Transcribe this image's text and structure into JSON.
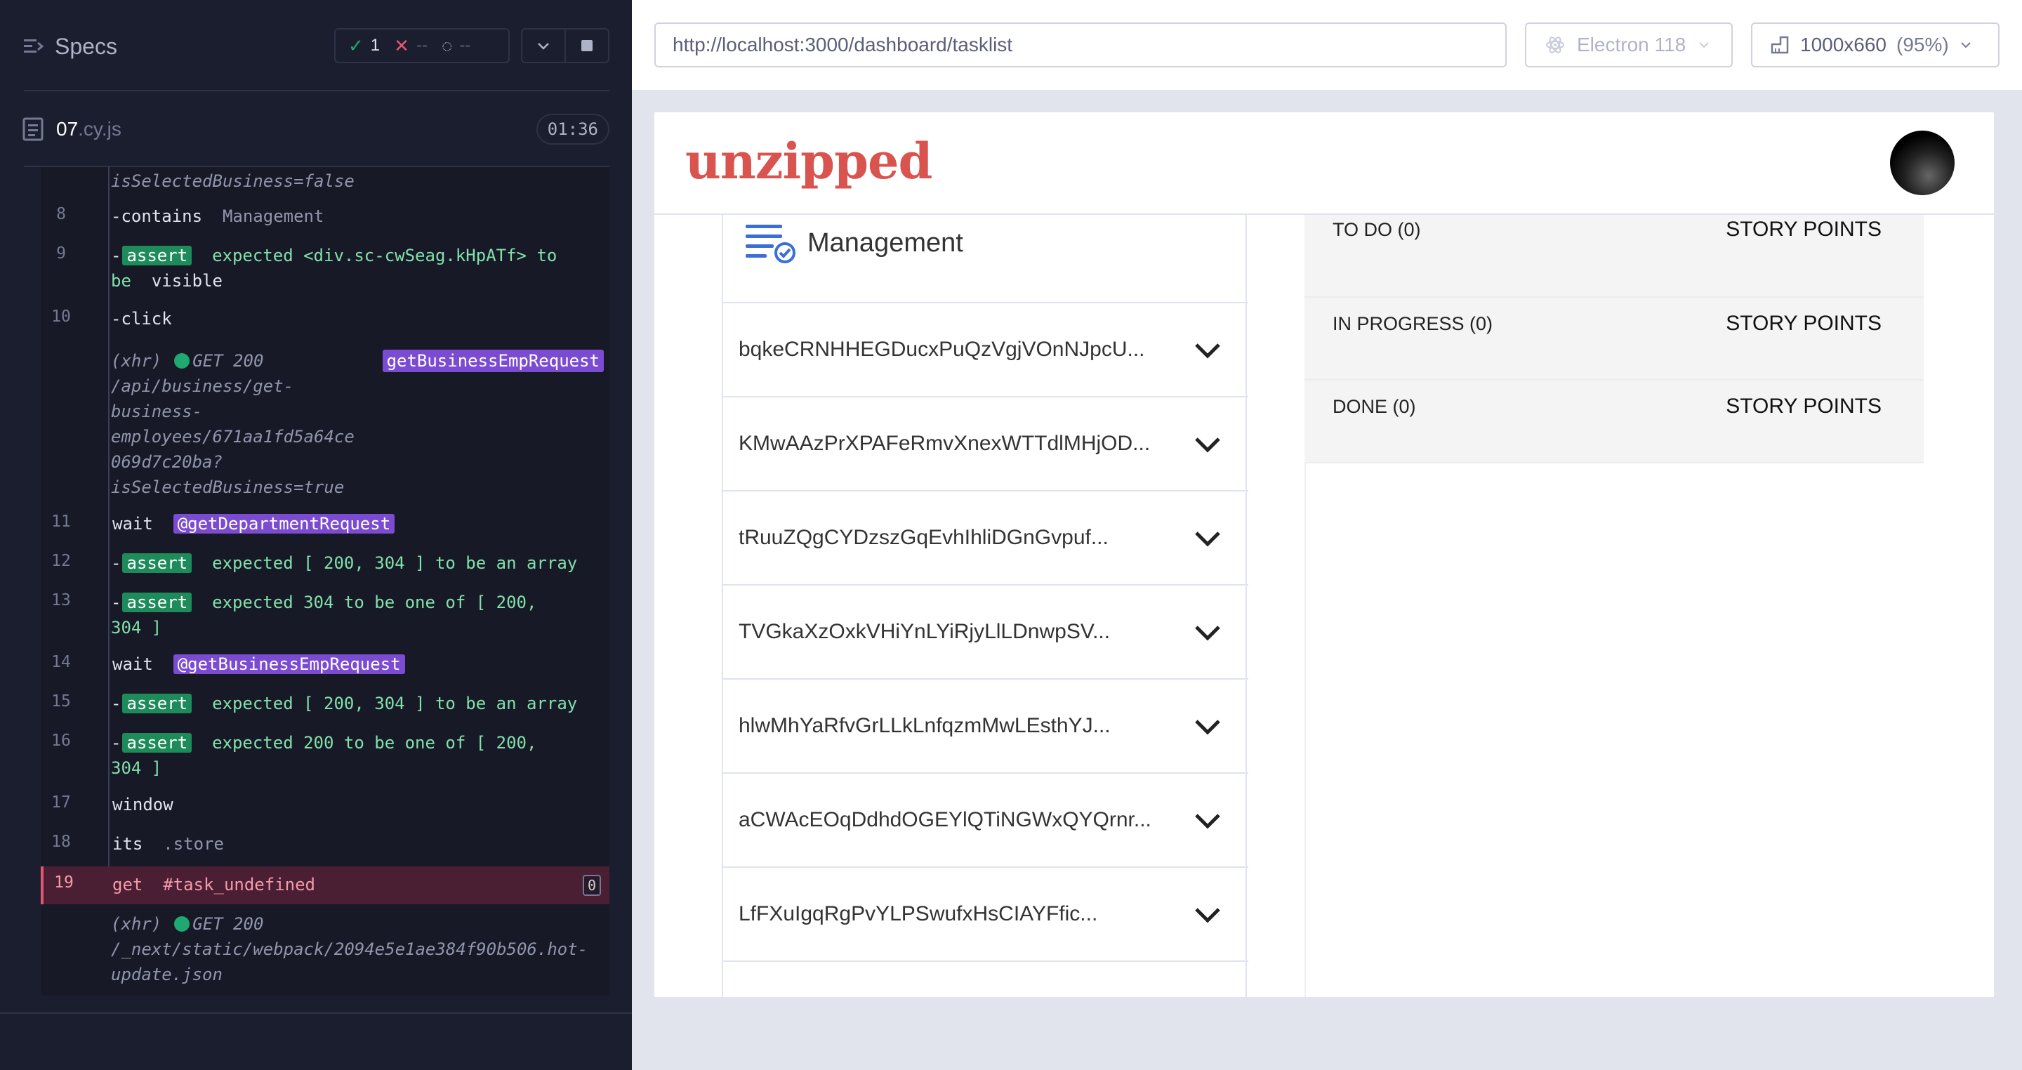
{
  "reporter": {
    "specs_label": "Specs",
    "stats": {
      "passed": "1",
      "failed": "--",
      "pending": "--"
    },
    "spec": {
      "name": "07",
      "ext": ".cy.js",
      "duration": "01:36"
    }
  },
  "commands": [
    {
      "num": "",
      "text": "isSelectedBusiness=false"
    },
    {
      "num": "8",
      "name": "-contains",
      "arg": "Management"
    },
    {
      "num": "9",
      "badge": "assert",
      "line1": "expected <div.sc-cwSeag.kHpATf> to",
      "line2a": "be",
      "line2b": "visible"
    },
    {
      "num": "10",
      "name": "-click"
    },
    {
      "num": "",
      "xhr": "(xhr)",
      "method": "GET 200",
      "alias": "getBusinessEmpRequest",
      "url_lines": [
        "/api/business/get-",
        "business-",
        "employees/671aa1fd5a64ce",
        "069d7c20ba?",
        "isSelectedBusiness=true"
      ]
    },
    {
      "num": "11",
      "name": "wait",
      "alias": "@getDepartmentRequest"
    },
    {
      "num": "12",
      "badge": "assert",
      "text": "expected [ 200, 304 ] to be an array"
    },
    {
      "num": "13",
      "badge": "assert",
      "line1": "expected 304 to be one of [ 200,",
      "line2": "304 ]"
    },
    {
      "num": "14",
      "name": "wait",
      "alias": "@getBusinessEmpRequest"
    },
    {
      "num": "15",
      "badge": "assert",
      "text": "expected [ 200, 304 ] to be an array"
    },
    {
      "num": "16",
      "badge": "assert",
      "line1": "expected 200 to be one of [ 200,",
      "line2": "304 ]"
    },
    {
      "num": "17",
      "name": "window"
    },
    {
      "num": "18",
      "name": "its",
      "arg": ".store"
    },
    {
      "num": "19",
      "name": "get",
      "arg": "#task_undefined",
      "count": "0"
    },
    {
      "num": "",
      "xhr": "(xhr)",
      "method": "GET 200",
      "url_lines": [
        "/_next/static/webpack/2094e5e1ae384f90b506.hot-",
        "update.json"
      ]
    }
  ],
  "browser": {
    "url": "http://localhost:3000/dashboard/tasklist",
    "name": "Electron 118",
    "viewport": "1000x660",
    "scale": "(95%)"
  },
  "app": {
    "logo": "unzipped",
    "column_title": "Management",
    "tasks": [
      "bqkeCRNHHEGDucxPuQzVgjVOnNJpcU...",
      "KMwAAzPrXPAFeRmvXnexWTTdlMHjOD...",
      "tRuuZQgCYDzszGqEvhIhliDGnGvpuf...",
      "TVGkaXzOxkVHiYnLYiRjyLlLDnwpSV...",
      "hlwMhYaRfvGrLLkLnfqzmMwLEsthYJ...",
      "aCWAcEOqDdhdOGEYlQTiNGWxQYQrnr...",
      "LfFXuIgqRgPvYLPSwufxHsCIAYFfic..."
    ],
    "statuses": [
      {
        "label": "TO DO (0)",
        "points": "STORY POINTS"
      },
      {
        "label": "IN PROGRESS (0)",
        "points": "STORY POINTS"
      },
      {
        "label": "DONE (0)",
        "points": "STORY POINTS"
      }
    ]
  },
  "colors": {
    "pass": "#1fa971",
    "fail": "#e45770",
    "brand": "#d9534f",
    "alias": "#7b4bd1"
  }
}
